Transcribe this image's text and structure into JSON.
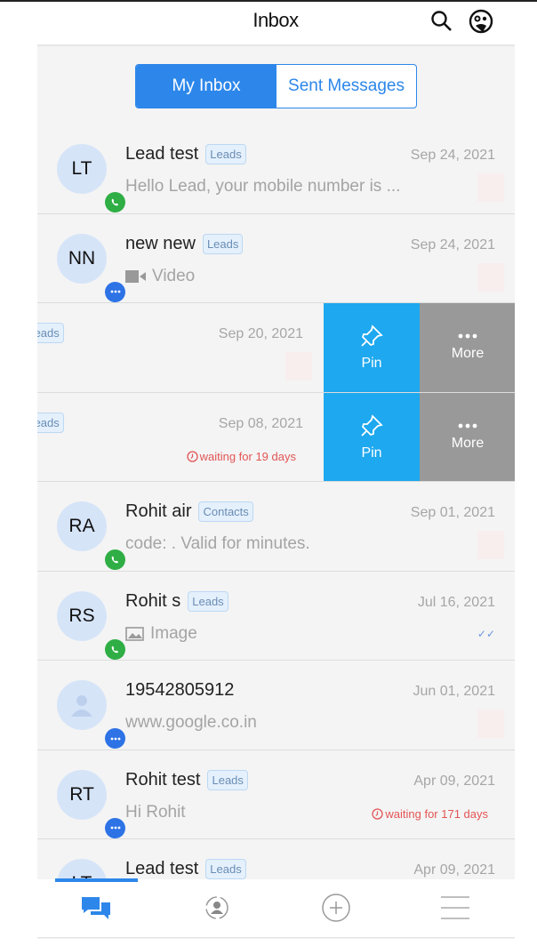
{
  "header": {
    "title": "Inbox",
    "icons": [
      "search-icon",
      "emoji-icon"
    ]
  },
  "tabs": [
    {
      "label": "My Inbox",
      "active": true
    },
    {
      "label": "Sent Messages",
      "active": false
    }
  ],
  "colors": {
    "accent": "#2d87ea",
    "pin": "#1ea8ef",
    "more": "#999999",
    "waiting": "#e25555",
    "whatsapp": "#2fae45"
  },
  "conversations": [
    {
      "initials": "LT",
      "name": "Lead test",
      "tag": "Leads",
      "date": "Sep 24, 2021",
      "preview": "Hello Lead, your mobile number is ...",
      "channel": "whatsapp"
    },
    {
      "initials": "NN",
      "name": "new new",
      "tag": "Leads",
      "date": "Sep 24, 2021",
      "preview": "Video",
      "preview_icon": "video-icon",
      "channel": "chat"
    },
    {
      "tag": "Leads",
      "date": "Sep 20, 2021",
      "swiped": true
    },
    {
      "tag": "Leads",
      "date": "Sep 08, 2021",
      "waiting": "waiting for 19 days",
      "swiped": true
    },
    {
      "initials": "RA",
      "name": "Rohit air",
      "tag": "Contacts",
      "date": "Sep 01, 2021",
      "preview": " code: . Valid for  minutes.",
      "channel": "whatsapp"
    },
    {
      "initials": "RS",
      "name": "Rohit s",
      "tag": "Leads",
      "date": "Jul 16, 2021",
      "preview": "Image",
      "preview_icon": "image-icon",
      "channel": "whatsapp",
      "read": true
    },
    {
      "initials": "",
      "name": "19542805912",
      "date": "Jun 01, 2021",
      "preview": "www.google.co.in",
      "channel": "chat"
    },
    {
      "initials": "RT",
      "name": "Rohit test",
      "tag": "Leads",
      "date": "Apr 09, 2021",
      "preview": "Hi Rohit",
      "waiting": "waiting for 171 days",
      "channel": "chat"
    },
    {
      "initials": "LT",
      "name": "Lead test",
      "tag": "Leads",
      "date": "Apr 09, 2021",
      "channel": "chat"
    }
  ],
  "swipe_actions": {
    "pin": "Pin",
    "more": "More"
  },
  "bottom_nav": [
    "chat-icon",
    "contact-sync-icon",
    "add-icon",
    "menu-icon"
  ]
}
